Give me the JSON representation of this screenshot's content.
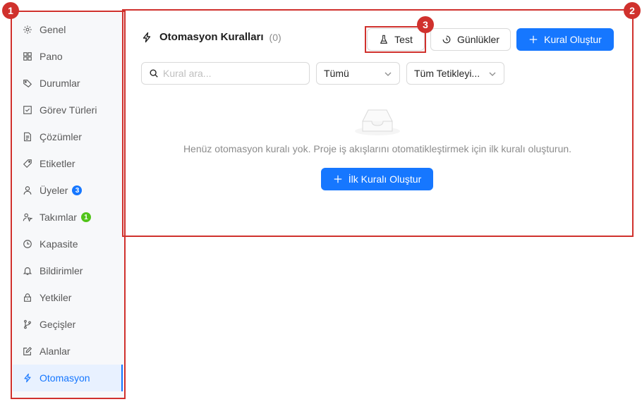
{
  "sidebar": {
    "items": [
      {
        "label": "Genel",
        "icon": "gear-icon"
      },
      {
        "label": "Pano",
        "icon": "grid-icon"
      },
      {
        "label": "Durumlar",
        "icon": "tag-icon"
      },
      {
        "label": "Görev Türleri",
        "icon": "checkbox-icon"
      },
      {
        "label": "Çözümler",
        "icon": "document-icon"
      },
      {
        "label": "Etiketler",
        "icon": "label-icon"
      },
      {
        "label": "Üyeler",
        "icon": "user-icon",
        "badge": "3",
        "badge_color": "#1677ff"
      },
      {
        "label": "Takımlar",
        "icon": "team-icon",
        "badge": "1",
        "badge_color": "#52c41a"
      },
      {
        "label": "Kapasite",
        "icon": "clock-icon"
      },
      {
        "label": "Bildirimler",
        "icon": "bell-icon"
      },
      {
        "label": "Yetkiler",
        "icon": "lock-icon"
      },
      {
        "label": "Geçişler",
        "icon": "branch-icon"
      },
      {
        "label": "Alanlar",
        "icon": "edit-icon"
      },
      {
        "label": "Otomasyon",
        "icon": "lightning-icon",
        "active": true
      }
    ]
  },
  "panel": {
    "title": "Otomasyon Kuralları",
    "count": "(0)",
    "test_label": "Test",
    "logs_label": "Günlükler",
    "create_label": "Kural Oluştur",
    "search_placeholder": "Kural ara...",
    "status_filter": "Tümü",
    "trigger_filter": "Tüm Tetikleyi...",
    "empty_text": "Henüz otomasyon kuralı yok. Proje iş akışlarını otomatikleştirmek için ilk kuralı oluşturun.",
    "first_rule_label": "İlk Kuralı Oluştur"
  },
  "annotations": [
    "1",
    "2",
    "3"
  ],
  "colors": {
    "accent": "#1677ff",
    "annotation": "#d0312d",
    "success": "#52c41a"
  }
}
